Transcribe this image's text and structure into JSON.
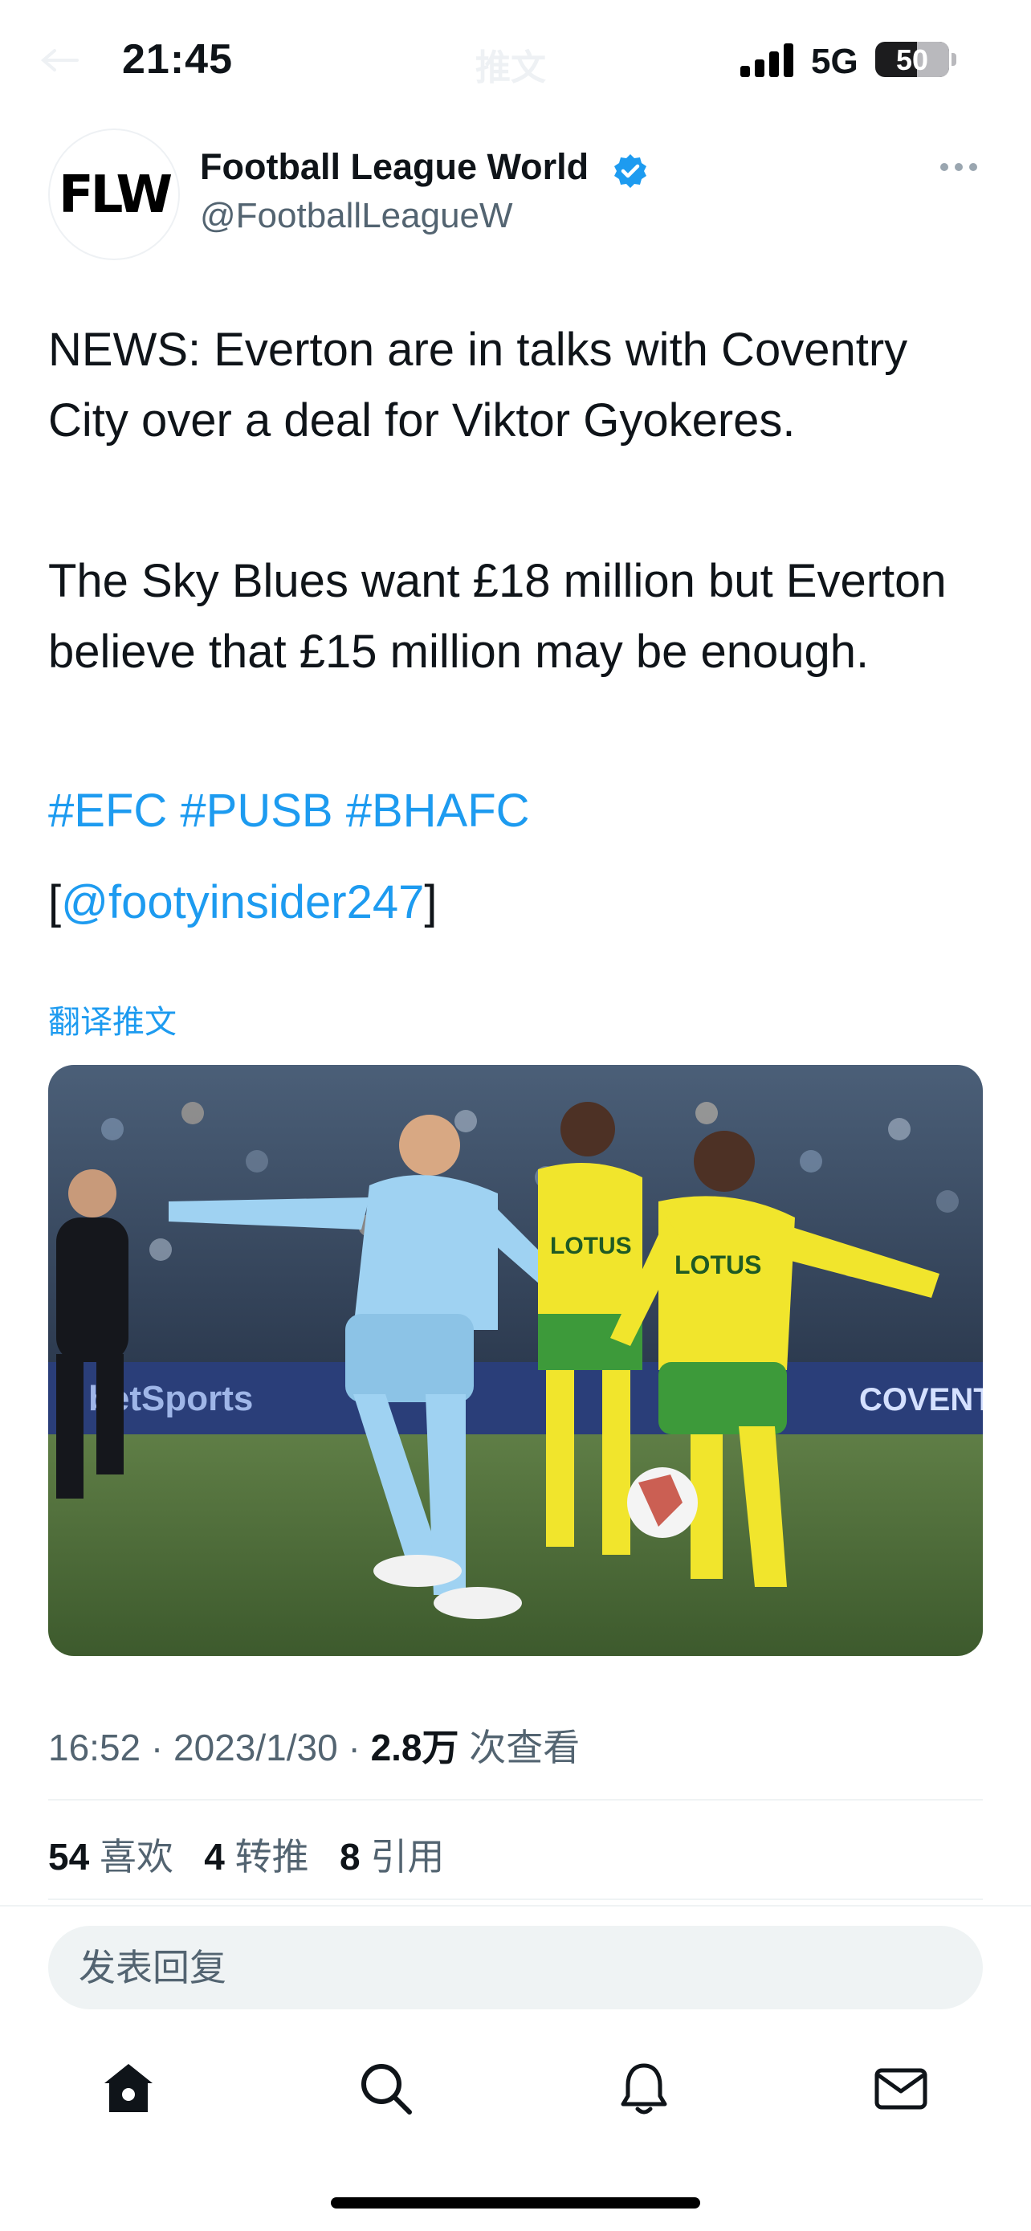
{
  "status_bar": {
    "time": "21:45",
    "center_title": "推文",
    "network": "5G",
    "battery": "50"
  },
  "tweet": {
    "author_name": "Football League World",
    "author_handle": "@FootballLeagueW",
    "avatar_text": "FLW",
    "paragraph1": "NEWS: Everton are in talks with Coventry City over a deal for Viktor Gyokeres.",
    "paragraph2": "The Sky Blues want £18 million but Everton believe that £15 million may be enough.",
    "hashtags": [
      "#EFC",
      "#PUSB",
      "#BHAFC"
    ],
    "mention_open": "[",
    "mention": "@footyinsider247",
    "mention_close": "]",
    "translate_label": "翻译推文",
    "photo_sponsor_texts": [
      "LOTUS",
      "LOTUS",
      "COVENTRY"
    ],
    "meta": {
      "time": "16:52",
      "sep": "·",
      "date": "2023/1/30",
      "views_count": "2.8万",
      "views_label": "次查看"
    },
    "stats": {
      "likes_count": "54",
      "likes_label": "喜欢",
      "retweets_count": "4",
      "retweets_label": "转推",
      "quotes_count": "8",
      "quotes_label": "引用"
    }
  },
  "reply": {
    "placeholder": "发表回复"
  },
  "tab_bar": {
    "icons": [
      "home-icon",
      "search-icon",
      "bell-icon",
      "mail-icon"
    ]
  },
  "colors": {
    "accent": "#1d9bf0",
    "secondary_text": "#536471",
    "coventry_blue": "#9fd2f2",
    "norwich_yellow": "#f1e52c",
    "norwich_green": "#3d9a3a"
  }
}
